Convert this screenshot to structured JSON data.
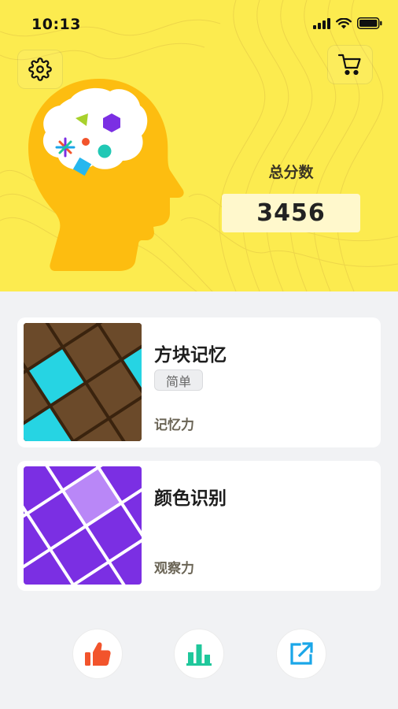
{
  "status_bar": {
    "time": "10:13",
    "icons": [
      "signal-icon",
      "wifi-icon",
      "battery-icon"
    ]
  },
  "header": {
    "settings_icon": "gear-icon",
    "cart_icon": "cart-icon",
    "illustration": "brain-head-illustration"
  },
  "score": {
    "label": "总分数",
    "value": "3456"
  },
  "games": [
    {
      "title": "方块记忆",
      "difficulty": "简单",
      "skill": "记忆力",
      "thumbnail": "tile-memory-thumbnail"
    },
    {
      "title": "颜色识别",
      "skill": "观察力",
      "thumbnail": "color-grid-thumbnail"
    }
  ],
  "bottom_actions": [
    {
      "icon": "thumbs-up-icon"
    },
    {
      "icon": "bar-chart-icon"
    },
    {
      "icon": "share-icon"
    }
  ],
  "colors": {
    "hero_background": "#FCEB4F",
    "head": "#FDBD10",
    "page_background": "#F1F2F4",
    "like": "#F2542C",
    "rank": "#1FC79B",
    "share": "#1AA6E8",
    "purple": "#7B2FE3",
    "tile_cyan": "#26D4E3",
    "tile_brown": "#6B4A2A"
  }
}
